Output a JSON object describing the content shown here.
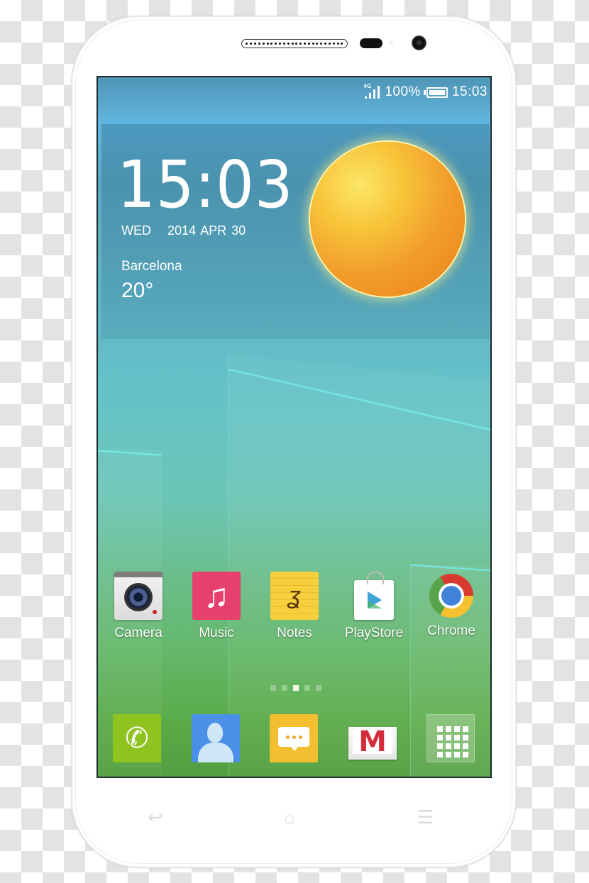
{
  "device": {
    "name": "Android smartphone (white)",
    "background": "transparency-checkerboard"
  },
  "status_bar": {
    "network": "4G",
    "signal_icon": "signal-bars-icon",
    "battery_percent": "100%",
    "battery_icon": "battery-full-icon",
    "time": "15:03"
  },
  "widget": {
    "clock": "15:03",
    "day_of_week": "WED",
    "date": "2014 APR 30",
    "city": "Barcelona",
    "temperature": "20°",
    "weather_icon": "sun-icon"
  },
  "apps": [
    {
      "label": "Camera",
      "icon": "camera-icon"
    },
    {
      "label": "Music",
      "icon": "music-note-icon",
      "glyph": "♫"
    },
    {
      "label": "Notes",
      "icon": "notes-icon",
      "glyph": "ʓ"
    },
    {
      "label": "PlayStore",
      "icon": "play-store-icon"
    },
    {
      "label": "Chrome",
      "icon": "chrome-icon"
    }
  ],
  "pager": {
    "pages": 5,
    "active_page": 3
  },
  "dock": [
    {
      "name": "Phone",
      "icon": "phone-icon",
      "glyph": "✆"
    },
    {
      "name": "Contacts",
      "icon": "contacts-icon"
    },
    {
      "name": "Messages",
      "icon": "messages-icon"
    },
    {
      "name": "Gmail",
      "icon": "gmail-icon",
      "glyph": "M"
    },
    {
      "name": "App drawer",
      "icon": "app-drawer-icon"
    }
  ],
  "nav_keys": {
    "back": "↩",
    "home": "⌂",
    "menu": "☰"
  },
  "colors": {
    "sun_core": "#f29d2c",
    "music": "#e6406e",
    "notes": "#f6cf3c",
    "phone": "#8fc320",
    "contacts": "#4a90e8",
    "messages": "#f3be30",
    "gmail_red": "#d32d3b"
  }
}
